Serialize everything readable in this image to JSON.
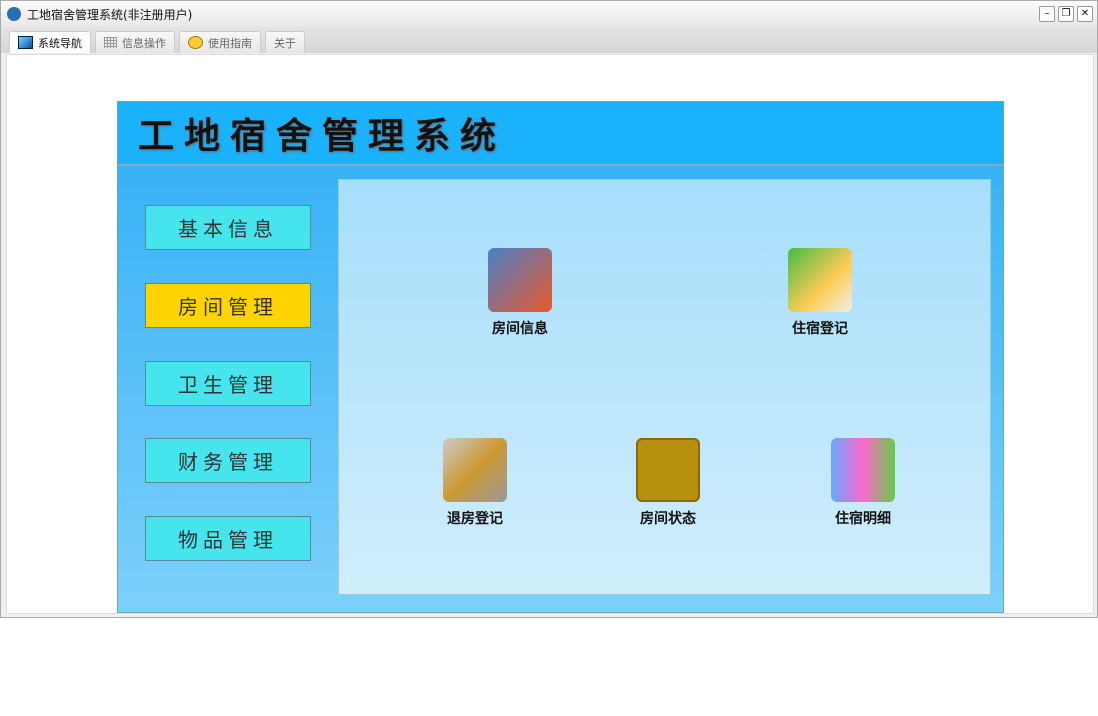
{
  "window": {
    "title": "工地宿舍管理系统(非注册用户)"
  },
  "tabs": [
    {
      "label": "系统导航"
    },
    {
      "label": "信息操作"
    },
    {
      "label": "使用指南"
    },
    {
      "label": "关于"
    }
  ],
  "app": {
    "title": "工地宿舍管理系统"
  },
  "nav": [
    {
      "label": "基本信息"
    },
    {
      "label": "房间管理"
    },
    {
      "label": "卫生管理"
    },
    {
      "label": "财务管理"
    },
    {
      "label": "物品管理"
    }
  ],
  "items": [
    {
      "label": "房间信息"
    },
    {
      "label": "住宿登记"
    },
    {
      "label": "退房登记"
    },
    {
      "label": "房间状态"
    },
    {
      "label": "住宿明细"
    }
  ]
}
